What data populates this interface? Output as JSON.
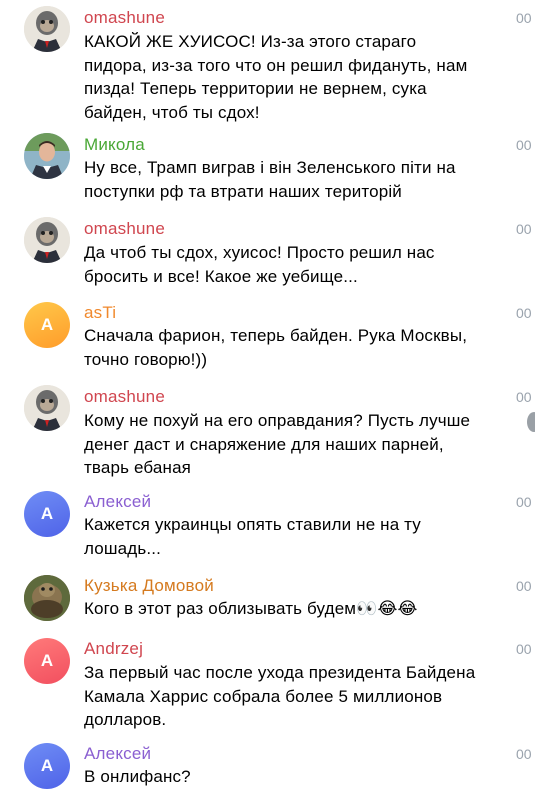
{
  "colors": {
    "name_red": "#d0464f",
    "name_green": "#4aa836",
    "name_orange": "#f0892d",
    "name_purple": "#8a5fd1",
    "name_brown": "#d57a1f",
    "time_gray": "#9aa3ad"
  },
  "messages": [
    {
      "author": "omashune",
      "avatar": "monkey-photo",
      "text": "КАКОЙ ЖЕ ХУИСОС! Из-за этого стараго\nпидора, из-за того что он решил фидануть, нам\nпизда! Теперь территории не вернем, сука\nбайден, чтоб ты сдох!",
      "time": "00"
    },
    {
      "author": "Микола",
      "avatar": "man-photo",
      "text": "Ну все, Трамп виграв і він Зеленського піти на\nпоступки рф та втрати наших територій",
      "time": "00"
    },
    {
      "author": "omashune",
      "avatar": "monkey-photo",
      "text": "Да чтоб ты сдох, хуисос! Просто решил нас\nбросить и все! Какое же уебище...",
      "time": "00"
    },
    {
      "author": "asTi",
      "avatar_letter": "A",
      "text": "Сначала фарион, теперь байден. Рука Москвы,\nточно говорю!))",
      "time": "00"
    },
    {
      "author": "omashune",
      "avatar": "monkey-photo",
      "text": "Кому не похуй на его оправдания? Пусть лучше\nденег даст и снаряжение для наших парней,\nтварь ебаная",
      "time": "00"
    },
    {
      "author": "Алексей",
      "avatar_letter": "A",
      "text": "Кажется украинцы опять ставили не на ту\nлошадь...",
      "time": "00"
    },
    {
      "author": "Кузька Домовой",
      "avatar": "turtle-photo",
      "text": "Кого в этот раз облизывать будем👀😂😂",
      "time": "00"
    },
    {
      "author": "Andrzej",
      "avatar_letter": "A",
      "text": "За первый час после ухода президента Байдена\nКамала Харрис собрала более 5 миллионов\nдолларов.",
      "time": "00"
    },
    {
      "author": "Алексей",
      "avatar_letter": "A",
      "text": "В онлифанс?",
      "time": "00"
    }
  ]
}
